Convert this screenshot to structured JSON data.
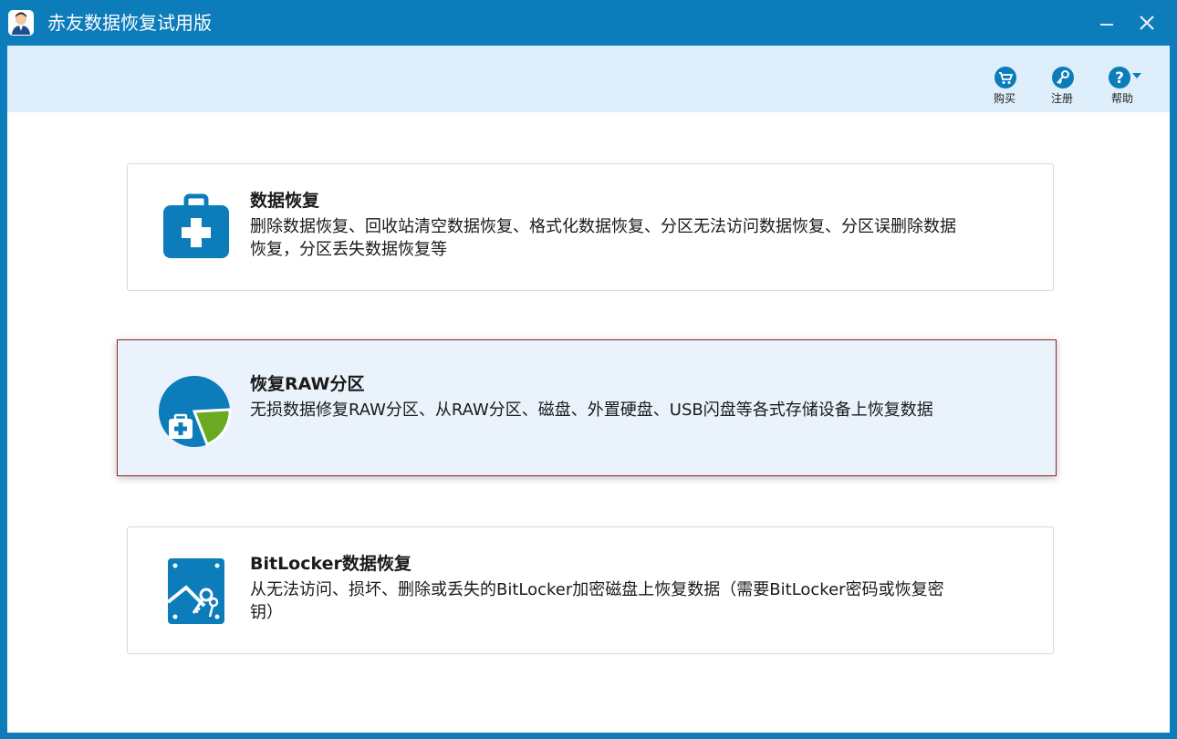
{
  "window": {
    "title": "赤友数据恢复试用版",
    "minimize_label": "minimize",
    "close_label": "close"
  },
  "toolbar": {
    "buy_label": "购买",
    "register_label": "注册",
    "help_label": "帮助"
  },
  "options": [
    {
      "title": "数据恢复",
      "description": "删除数据恢复、回收站清空数据恢复、格式化数据恢复、分区无法访问数据恢复、分区误删除数据恢复，分区丢失数据恢复等",
      "selected": false
    },
    {
      "title": "恢复RAW分区",
      "description": "无损数据修复RAW分区、从RAW分区、磁盘、外置硬盘、USB闪盘等各式存储设备上恢复数据",
      "selected": true
    },
    {
      "title": "BitLocker数据恢复",
      "description": "从无法访问、损坏、删除或丢失的BitLocker加密磁盘上恢复数据（需要BitLocker密码或恢复密钥）",
      "selected": false
    }
  ],
  "colors": {
    "titlebar": "#0c7cba",
    "toolbar": "#deeefb",
    "icon_blue": "#0c7cba",
    "pie_green": "#6aaa20",
    "selected_border": "#9b2224",
    "selected_bg": "#eaf3fc"
  }
}
